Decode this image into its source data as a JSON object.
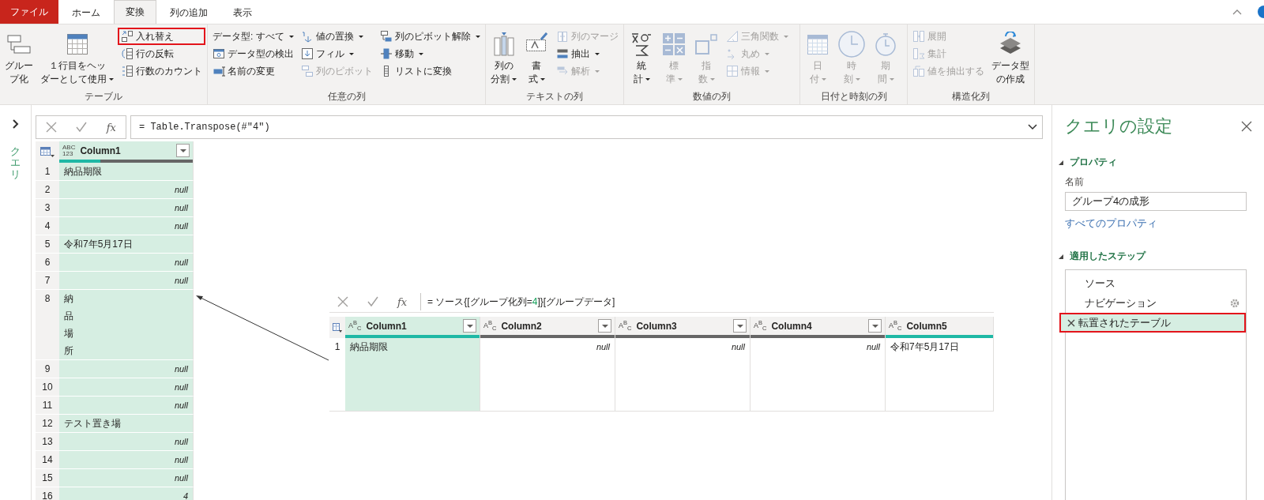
{
  "ribbon_tabs": [
    {
      "label": "ファイル",
      "kind": "file",
      "selected": false
    },
    {
      "label": "ホーム",
      "kind": "tab",
      "selected": false
    },
    {
      "label": "変換",
      "kind": "tab",
      "selected": true
    },
    {
      "label": "列の追加",
      "kind": "tab",
      "selected": false
    },
    {
      "label": "表示",
      "kind": "tab",
      "selected": false
    }
  ],
  "ribbon_groups": [
    {
      "label": "テーブル",
      "items": [
        {
          "kind": "large",
          "label_lines": [
            "グルー",
            "プ化"
          ],
          "dropdown": false,
          "disabled": false,
          "highlighted": false
        },
        {
          "kind": "large",
          "label_lines": [
            "１行目をヘッ",
            "ダーとして使用"
          ],
          "dropdown": true,
          "disabled": false,
          "highlighted": false
        },
        {
          "kind": "stack",
          "items": [
            {
              "label": "入れ替え",
              "dropdown": false,
              "disabled": false,
              "highlighted": true
            },
            {
              "label": "行の反転",
              "dropdown": false,
              "disabled": false,
              "highlighted": false
            },
            {
              "label": "行数のカウント",
              "dropdown": false,
              "disabled": false,
              "highlighted": false
            }
          ]
        }
      ]
    },
    {
      "label": "任意の列",
      "items": [
        {
          "kind": "stack",
          "items": [
            {
              "label": "データ型: すべて",
              "dropdown": true,
              "disabled": false,
              "highlighted": false
            },
            {
              "label": "データ型の検出",
              "dropdown": false,
              "disabled": false,
              "highlighted": false
            },
            {
              "label": "名前の変更",
              "dropdown": false,
              "disabled": false,
              "highlighted": false
            }
          ]
        },
        {
          "kind": "stack",
          "items": [
            {
              "label": "値の置換",
              "dropdown": true,
              "disabled": false,
              "highlighted": false
            },
            {
              "label": "フィル",
              "dropdown": true,
              "disabled": false,
              "highlighted": false
            },
            {
              "label": "列のピボット",
              "dropdown": false,
              "disabled": true,
              "highlighted": false
            }
          ]
        },
        {
          "kind": "stack",
          "items": [
            {
              "label": "列のピボット解除",
              "dropdown": true,
              "disabled": false,
              "highlighted": false
            },
            {
              "label": "移動",
              "dropdown": true,
              "disabled": false,
              "highlighted": false
            },
            {
              "label": "リストに変換",
              "dropdown": false,
              "disabled": false,
              "highlighted": false
            }
          ]
        }
      ]
    },
    {
      "label": "テキストの列",
      "items": [
        {
          "kind": "large",
          "label_lines": [
            "列の",
            "分割"
          ],
          "dropdown": true,
          "disabled": false,
          "highlighted": false
        },
        {
          "kind": "large",
          "label_lines": [
            "書",
            "式"
          ],
          "dropdown": true,
          "disabled": false,
          "highlighted": false
        },
        {
          "kind": "stack",
          "items": [
            {
              "label": "列のマージ",
              "dropdown": false,
              "disabled": true,
              "highlighted": false
            },
            {
              "label": "抽出",
              "dropdown": true,
              "disabled": false,
              "highlighted": false
            },
            {
              "label": "解析",
              "dropdown": true,
              "disabled": true,
              "highlighted": false
            }
          ]
        }
      ]
    },
    {
      "label": "数値の列",
      "items": [
        {
          "kind": "large",
          "label_lines": [
            "統",
            "計"
          ],
          "dropdown": true,
          "disabled": false,
          "highlighted": false
        },
        {
          "kind": "large",
          "label_lines": [
            "標",
            "準"
          ],
          "dropdown": true,
          "disabled": true,
          "highlighted": false
        },
        {
          "kind": "large",
          "label_lines": [
            "指",
            "数"
          ],
          "dropdown": true,
          "disabled": true,
          "highlighted": false
        },
        {
          "kind": "stack",
          "items": [
            {
              "label": "三角関数",
              "dropdown": true,
              "disabled": true,
              "highlighted": false
            },
            {
              "label": "丸め",
              "dropdown": true,
              "disabled": true,
              "highlighted": false
            },
            {
              "label": "情報",
              "dropdown": true,
              "disabled": true,
              "highlighted": false
            }
          ]
        }
      ]
    },
    {
      "label": "日付と時刻の列",
      "items": [
        {
          "kind": "large",
          "label_lines": [
            "日",
            "付"
          ],
          "dropdown": true,
          "disabled": true,
          "highlighted": false
        },
        {
          "kind": "large",
          "label_lines": [
            "時",
            "刻"
          ],
          "dropdown": true,
          "disabled": true,
          "highlighted": false
        },
        {
          "kind": "large",
          "label_lines": [
            "期",
            "間"
          ],
          "dropdown": true,
          "disabled": true,
          "highlighted": false
        }
      ]
    },
    {
      "label": "構造化列",
      "items": [
        {
          "kind": "stack",
          "items": [
            {
              "label": "展開",
              "dropdown": false,
              "disabled": true,
              "highlighted": false
            },
            {
              "label": "集計",
              "dropdown": false,
              "disabled": true,
              "highlighted": false
            },
            {
              "label": "値を抽出する",
              "dropdown": false,
              "disabled": true,
              "highlighted": false
            }
          ]
        },
        {
          "kind": "large",
          "label_lines": [
            "データ型",
            "の作成"
          ],
          "dropdown": false,
          "disabled": false,
          "highlighted": false
        }
      ]
    }
  ],
  "queries_pane": {
    "title": "クエリ",
    "expanded": false
  },
  "formula_bar": {
    "function_label": "fx",
    "formula": "= Table.Transpose(#\"4\")"
  },
  "table": {
    "columns": [
      {
        "name": "Column1",
        "type_label": "ABC\n123",
        "selected": true,
        "level": 0.31,
        "filter_button": true
      }
    ],
    "rows": [
      {
        "number": "1",
        "cells": [
          {
            "text": "納品期限",
            "kind": "text"
          }
        ]
      },
      {
        "number": "2",
        "cells": [
          {
            "text": "null",
            "kind": "null"
          }
        ]
      },
      {
        "number": "3",
        "cells": [
          {
            "text": "null",
            "kind": "null"
          }
        ]
      },
      {
        "number": "4",
        "cells": [
          {
            "text": "null",
            "kind": "null"
          }
        ]
      },
      {
        "number": "5",
        "cells": [
          {
            "text": "令和7年5月17日",
            "kind": "text"
          }
        ]
      },
      {
        "number": "6",
        "cells": [
          {
            "text": "null",
            "kind": "null"
          }
        ]
      },
      {
        "number": "7",
        "cells": [
          {
            "text": "null",
            "kind": "null"
          }
        ]
      },
      {
        "number": "8",
        "cells": [
          {
            "text": "納品場所",
            "kind": "stacked"
          }
        ]
      },
      {
        "number": "9",
        "cells": [
          {
            "text": "null",
            "kind": "null"
          }
        ]
      },
      {
        "number": "10",
        "cells": [
          {
            "text": "null",
            "kind": "null"
          }
        ]
      },
      {
        "number": "11",
        "cells": [
          {
            "text": "null",
            "kind": "null"
          }
        ]
      },
      {
        "number": "12",
        "cells": [
          {
            "text": "テスト置き場",
            "kind": "text"
          }
        ]
      },
      {
        "number": "13",
        "cells": [
          {
            "text": "null",
            "kind": "null"
          }
        ]
      },
      {
        "number": "14",
        "cells": [
          {
            "text": "null",
            "kind": "null"
          }
        ]
      },
      {
        "number": "15",
        "cells": [
          {
            "text": "null",
            "kind": "null"
          }
        ]
      },
      {
        "number": "16",
        "cells": [
          {
            "text": "4",
            "kind": "number"
          }
        ]
      }
    ]
  },
  "inset": {
    "function_label": "fx",
    "formula_parts": [
      {
        "text": "= ソース{[グループ化列=",
        "kind": "plain"
      },
      {
        "text": "4",
        "kind": "number"
      },
      {
        "text": "]}[グループデータ]",
        "kind": "plain"
      }
    ],
    "columns": [
      {
        "name": "Column1",
        "type_label": "A$^{B}$$_{C}$",
        "selected": true,
        "level": 1,
        "filter_button": true
      },
      {
        "name": "Column2",
        "type_label": "A$^{B}$$_{C}$",
        "selected": false,
        "level": 0,
        "filter_button": true
      },
      {
        "name": "Column3",
        "type_label": "A$^{B}$$_{C}$",
        "selected": false,
        "level": 0,
        "filter_button": true
      },
      {
        "name": "Column4",
        "type_label": "A$^{B}$$_{C}$",
        "selected": false,
        "level": 0,
        "filter_button": true
      },
      {
        "name": "Column5",
        "type_label": "A$^{B}$$_{C}$",
        "selected": false,
        "level": 1,
        "filter_button": false
      }
    ],
    "rows": [
      {
        "number": "1",
        "cells": [
          {
            "text": "納品期限",
            "kind": "text"
          },
          {
            "text": "null",
            "kind": "null"
          },
          {
            "text": "null",
            "kind": "null"
          },
          {
            "text": "null",
            "kind": "null"
          },
          {
            "text": "令和7年5月17日",
            "kind": "text"
          }
        ]
      }
    ]
  },
  "query_settings": {
    "title": "クエリの設定",
    "properties": {
      "title": "プロパティ",
      "expanded": true,
      "name_label": "名前",
      "name_value": "グループ4の成形",
      "link": "すべてのプロパティ"
    },
    "applied_steps": {
      "title": "適用したステップ",
      "expanded": true,
      "steps": [
        {
          "label": "ソース",
          "selected": false,
          "highlighted": false,
          "settings": false
        },
        {
          "label": "ナビゲーション",
          "selected": false,
          "highlighted": false,
          "settings": true
        },
        {
          "label": "転置されたテーブル",
          "selected": true,
          "highlighted": true,
          "settings": false
        }
      ]
    }
  }
}
